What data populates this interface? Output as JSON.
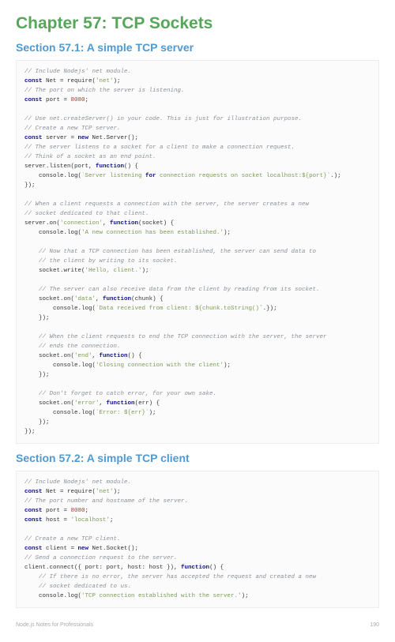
{
  "chapter_title": "Chapter 57: TCP Sockets",
  "section1_title": "Section 57.1: A simple TCP server",
  "section2_title": "Section 57.2: A simple TCP client",
  "footer_left": "Node.js Notes for Professionals",
  "footer_right": "190",
  "c1": {
    "l01": "// Include Nodejs' net module.",
    "l02a": "const",
    "l02b": " Net = require(",
    "l02c": "'net'",
    "l02d": ");",
    "l03": "// The port on which the server is listening.",
    "l04a": "const",
    "l04b": " port = ",
    "l04c": "8080",
    "l04d": ";",
    "l05": "// Use net.createServer() in your code. This is just for illustration purpose.",
    "l06": "// Create a new TCP server.",
    "l07a": "const",
    "l07b": " server = ",
    "l07c": "new",
    "l07d": " Net.Server();",
    "l08": "// The server listens to a socket for a client to make a connection request.",
    "l09": "// Think of a socket as an end point.",
    "l10a": "server.listen(port, ",
    "l10b": "function",
    "l10c": "() {",
    "l11a": "    console.log(",
    "l11b": "`Server listening ",
    "l11c": "for",
    "l11d": " connection requests on socket localhost:${port}`",
    "l11e": ".);",
    "l12": "});",
    "l13": "// When a client requests a connection with the server, the server creates a new",
    "l14": "// socket dedicated to that client.",
    "l15a": "server.on(",
    "l15b": "'connection'",
    "l15c": ", ",
    "l15d": "function",
    "l15e": "(socket) {",
    "l16a": "    console.log(",
    "l16b": "'A new connection has been established.'",
    "l16c": ");",
    "l17": "    // Now that a TCP connection has been established, the server can send data to",
    "l18": "    // the client by writing to its socket.",
    "l19a": "    socket.write(",
    "l19b": "'Hello, client.'",
    "l19c": ");",
    "l20": "    // The server can also receive data from the client by reading from its socket.",
    "l21a": "    socket.on(",
    "l21b": "'data'",
    "l21c": ", ",
    "l21d": "function",
    "l21e": "(chunk) {",
    "l22a": "        console.log(",
    "l22b": "`Data received from client: ${chunk.toString()",
    "l22c": "`.});",
    "l23": "    });",
    "l24": "    // When the client requests to end the TCP connection with the server, the server",
    "l25": "    // ends the connection.",
    "l26a": "    socket.on(",
    "l26b": "'end'",
    "l26c": ", ",
    "l26d": "function",
    "l26e": "() {",
    "l27a": "        console.log(",
    "l27b": "'Closing connection with the client'",
    "l27c": ");",
    "l28": "    });",
    "l29": "    // Don't forget to catch error, for your own sake.",
    "l30a": "    socket.on(",
    "l30b": "'error'",
    "l30c": ", ",
    "l30d": "function",
    "l30e": "(err) {",
    "l31a": "        console.log(",
    "l31b": "`Error: ${err}`",
    "l31c": ");",
    "l32": "    });",
    "l33": "});"
  },
  "c2": {
    "l01": "// Include Nodejs' net module.",
    "l02a": "const",
    "l02b": " Net = require(",
    "l02c": "'net'",
    "l02d": ");",
    "l03": "// The port number and hostname of the server.",
    "l04a": "const",
    "l04b": " port = ",
    "l04c": "8080",
    "l04d": ";",
    "l05a": "const",
    "l05b": " host = ",
    "l05c": "'localhost'",
    "l05d": ";",
    "l06": "// Create a new TCP client.",
    "l07a": "const",
    "l07b": " client = ",
    "l07c": "new",
    "l07d": " Net.Socket();",
    "l08": "// Send a connection request to the server.",
    "l09a": "client.connect({ port: port, host: host }), ",
    "l09b": "function",
    "l09c": "() {",
    "l10": "    // If there is no error, the server has accepted the request and created a new",
    "l11": "    // socket dedicated to us.",
    "l12a": "    console.log(",
    "l12b": "'TCP connection established with the server.'",
    "l12c": ");"
  }
}
